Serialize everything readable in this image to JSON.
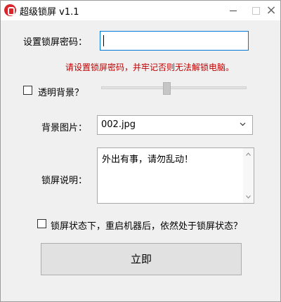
{
  "window": {
    "title": "超级锁屏 v1.1",
    "controls": [
      "minimize",
      "maximize",
      "close"
    ],
    "close_glyph": "×"
  },
  "form": {
    "password_label": "设置锁屏密码：",
    "password_value": "",
    "warning": "请设置锁屏密码，并牢记否则无法解锁电脑。",
    "transparent_label": "透明背景？",
    "transparent_checked": false,
    "slider_level_percent": 45,
    "background_label": "背景图片：",
    "background_selected": "002.jpg",
    "description_label": "锁屏说明：",
    "description_value": "外出有事，请勿乱动！",
    "persist_label": "锁屏状态下，重启机器后，依然处于锁屏状态？",
    "persist_checked": false,
    "submit_label": "立即"
  },
  "colors": {
    "warning": "#c00000",
    "focus_border": "#0078d7",
    "app_icon": "#d8262c"
  }
}
